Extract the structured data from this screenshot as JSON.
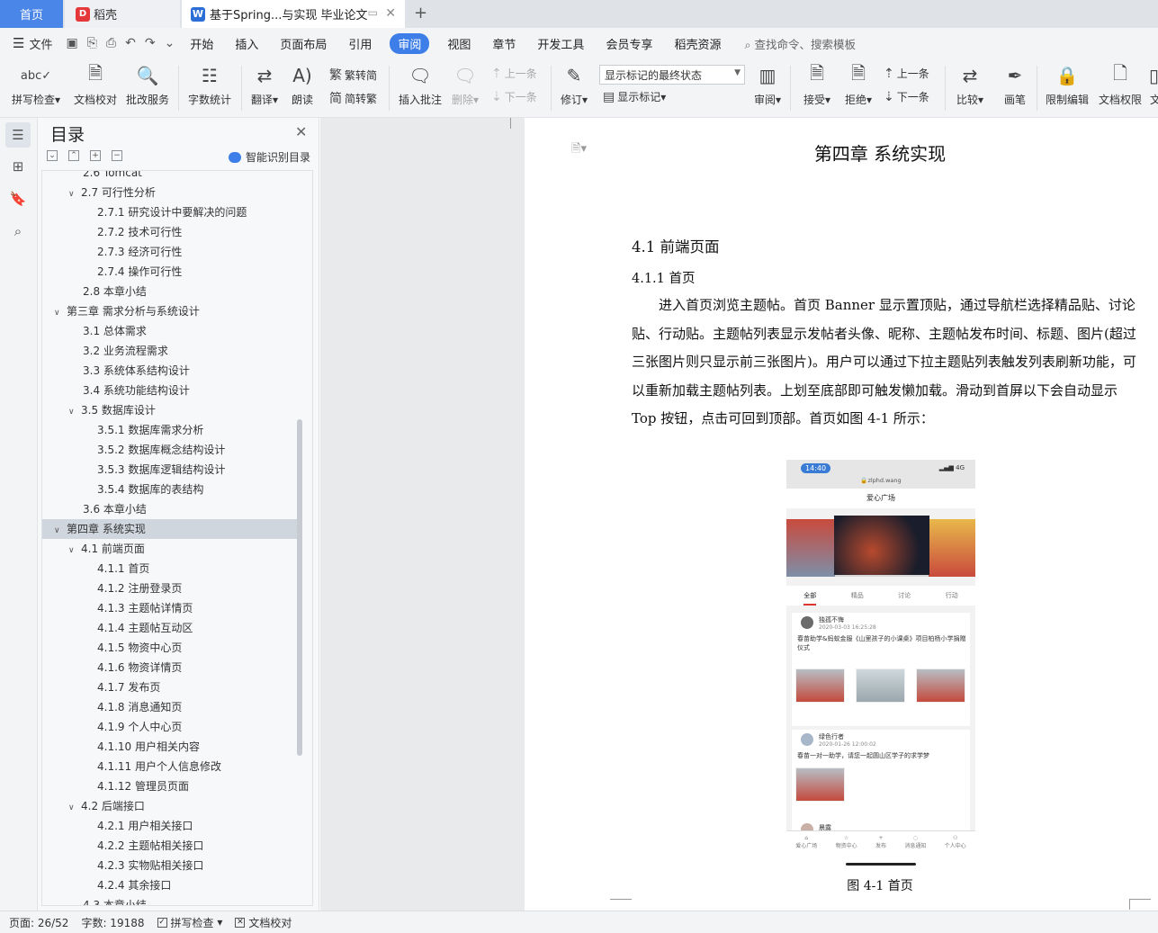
{
  "tabs": {
    "home": "首页",
    "daoke": "稻壳",
    "doc": "基于Spring...与实现 毕业论文"
  },
  "menu": {
    "file": "文件",
    "items": [
      "开始",
      "插入",
      "页面布局",
      "引用",
      "审阅",
      "视图",
      "章节",
      "开发工具",
      "会员专享",
      "稻壳资源"
    ],
    "active_index": 4,
    "search": "查找命令、搜索模板"
  },
  "ribbon": {
    "spell": "拼写检查",
    "proofread": "文档校对",
    "batch": "批改服务",
    "wordcount": "字数统计",
    "translate": "翻译",
    "read": "朗读",
    "trad": "繁转简",
    "simp": "简转繁",
    "insert_comment": "插入批注",
    "delete": "删除",
    "prev_comment": "上一条",
    "next_comment": "下一条",
    "revise": "修订",
    "markup_state": "显示标记的最终状态",
    "show_markup": "显示标记",
    "review": "审阅",
    "accept": "接受",
    "reject": "拒绝",
    "prev_change": "上一条",
    "next_change": "下一条",
    "compare": "比较",
    "pen": "画笔",
    "restrict": "限制编辑",
    "perm": "文档权限",
    "cut_label": "文"
  },
  "toc": {
    "title": "目录",
    "smart": "智能识别目录",
    "items": [
      {
        "label": "2.6 Tomcat",
        "level": 1,
        "arrow": ""
      },
      {
        "label": "2.7  可行性分析",
        "level": 1,
        "arrow": "open"
      },
      {
        "label": "2.7.1  研究设计中要解决的问题",
        "level": 2,
        "arrow": ""
      },
      {
        "label": "2.7.2  技术可行性",
        "level": 2,
        "arrow": ""
      },
      {
        "label": "2.7.3  经济可行性",
        "level": 2,
        "arrow": ""
      },
      {
        "label": "2.7.4  操作可行性",
        "level": 2,
        "arrow": ""
      },
      {
        "label": "2.8  本章小结",
        "level": 1,
        "arrow": ""
      },
      {
        "label": "第三章  需求分析与系统设计",
        "level": 0,
        "arrow": "open"
      },
      {
        "label": "3.1  总体需求",
        "level": 1,
        "arrow": ""
      },
      {
        "label": "3.2  业务流程需求",
        "level": 1,
        "arrow": ""
      },
      {
        "label": "3.3  系统体系结构设计",
        "level": 1,
        "arrow": ""
      },
      {
        "label": "3.4  系统功能结构设计",
        "level": 1,
        "arrow": ""
      },
      {
        "label": "3.5  数据库设计",
        "level": 1,
        "arrow": "open"
      },
      {
        "label": "3.5.1  数据库需求分析",
        "level": 2,
        "arrow": ""
      },
      {
        "label": "3.5.2  数据库概念结构设计",
        "level": 2,
        "arrow": ""
      },
      {
        "label": "3.5.3  数据库逻辑结构设计",
        "level": 2,
        "arrow": ""
      },
      {
        "label": "3.5.4  数据库的表结构",
        "level": 2,
        "arrow": ""
      },
      {
        "label": "3.6  本章小结",
        "level": 1,
        "arrow": ""
      },
      {
        "label": "第四章  系统实现",
        "level": 0,
        "arrow": "open",
        "selected": true
      },
      {
        "label": "4.1  前端页面",
        "level": 1,
        "arrow": "open"
      },
      {
        "label": "4.1.1  首页",
        "level": 2,
        "arrow": ""
      },
      {
        "label": "4.1.2  注册登录页",
        "level": 2,
        "arrow": ""
      },
      {
        "label": "4.1.3  主题帖详情页",
        "level": 2,
        "arrow": ""
      },
      {
        "label": "4.1.4  主题帖互动区",
        "level": 2,
        "arrow": ""
      },
      {
        "label": "4.1.5  物资中心页",
        "level": 2,
        "arrow": ""
      },
      {
        "label": "4.1.6  物资详情页",
        "level": 2,
        "arrow": ""
      },
      {
        "label": "4.1.7  发布页",
        "level": 2,
        "arrow": ""
      },
      {
        "label": "4.1.8  消息通知页",
        "level": 2,
        "arrow": ""
      },
      {
        "label": "4.1.9  个人中心页",
        "level": 2,
        "arrow": ""
      },
      {
        "label": "4.1.10  用户相关内容",
        "level": 2,
        "arrow": ""
      },
      {
        "label": "4.1.11  用户个人信息修改",
        "level": 2,
        "arrow": ""
      },
      {
        "label": "4.1.12  管理员页面",
        "level": 2,
        "arrow": ""
      },
      {
        "label": "4.2  后端接口",
        "level": 1,
        "arrow": "open"
      },
      {
        "label": "4.2.1  用户相关接口",
        "level": 2,
        "arrow": ""
      },
      {
        "label": "4.2.2  主题帖相关接口",
        "level": 2,
        "arrow": ""
      },
      {
        "label": "4.2.3  实物贴相关接口",
        "level": 2,
        "arrow": ""
      },
      {
        "label": "4.2.4  其余接口",
        "level": 2,
        "arrow": ""
      },
      {
        "label": "4.3  本章小结",
        "level": 1,
        "arrow": ""
      }
    ]
  },
  "doc": {
    "chapter": "第四章  系统实现",
    "h2": "4.1  前端页面",
    "h3": "4.1.1  首页",
    "para": "进入首页浏览主题帖。首页 Banner 显示置顶贴，通过导航栏选择精品贴、讨论贴、行动贴。主题帖列表显示发帖者头像、昵称、主题帖发布时间、标题、图片(超过三张图片则只显示前三张图片)。用户可以通过下拉主题贴列表触发列表刷新功能，可以重新加载主题帖列表。上划至底部即可触发懒加载。滑动到首屏以下会自动显示 Top 按钮，点击可回到顶部。首页如图 4-1 所示：",
    "caption": "图 4-1  首页"
  },
  "phone": {
    "time": "14:40",
    "net": "4G",
    "url": "zlphd.wang",
    "title": "爱心广场",
    "tabs": [
      "全部",
      "精品",
      "讨论",
      "行动"
    ],
    "post1": {
      "name": "独孤不悔",
      "time": "2020-03-03 16:25:28",
      "text": "春苗助学&蚂蚁金服《山里孩子的小课桌》项目柏杨小学捐赠仪式"
    },
    "post2": {
      "name": "绿色行者",
      "time": "2020-01-26 12:00:02",
      "text": "春苗一对一助学，请您一起圆山区学子的求学梦"
    },
    "post3": {
      "name": "晨露"
    },
    "nav": [
      "爱心广场",
      "物资中心",
      "发布",
      "消息通知",
      "个人中心"
    ]
  },
  "status": {
    "page": "页面: 26/52",
    "words": "字数: 19188",
    "spell": "拼写检查",
    "proof": "文档校对"
  }
}
